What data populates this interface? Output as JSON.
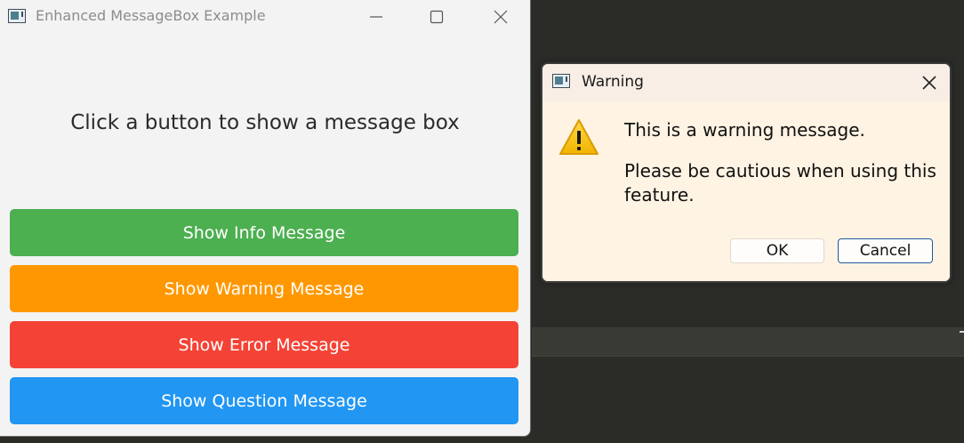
{
  "main_window": {
    "title": "Enhanced MessageBox Example",
    "prompt": "Click a button to show a message box",
    "controls": {
      "minimize_icon": "minimize-icon",
      "maximize_icon": "maximize-icon",
      "close_icon": "close-icon"
    },
    "buttons": [
      {
        "label": "Show Info Message",
        "color": "#4caf50"
      },
      {
        "label": "Show Warning Message",
        "color": "#ff9800"
      },
      {
        "label": "Show Error Message",
        "color": "#f44336"
      },
      {
        "label": "Show Question Message",
        "color": "#2196f3"
      }
    ]
  },
  "dialog": {
    "title": "Warning",
    "icon": "warning-icon",
    "message": "This is a warning message.",
    "detail": "Please be cautious when using this feature.",
    "ok_label": "OK",
    "cancel_label": "Cancel"
  },
  "colors": {
    "background": "#2b2b28",
    "window_bg": "#f3f3f3",
    "dialog_bg": "#fff3e3",
    "default_button_border": "#1f5a9c",
    "warning_yellow": "#f7c400"
  }
}
